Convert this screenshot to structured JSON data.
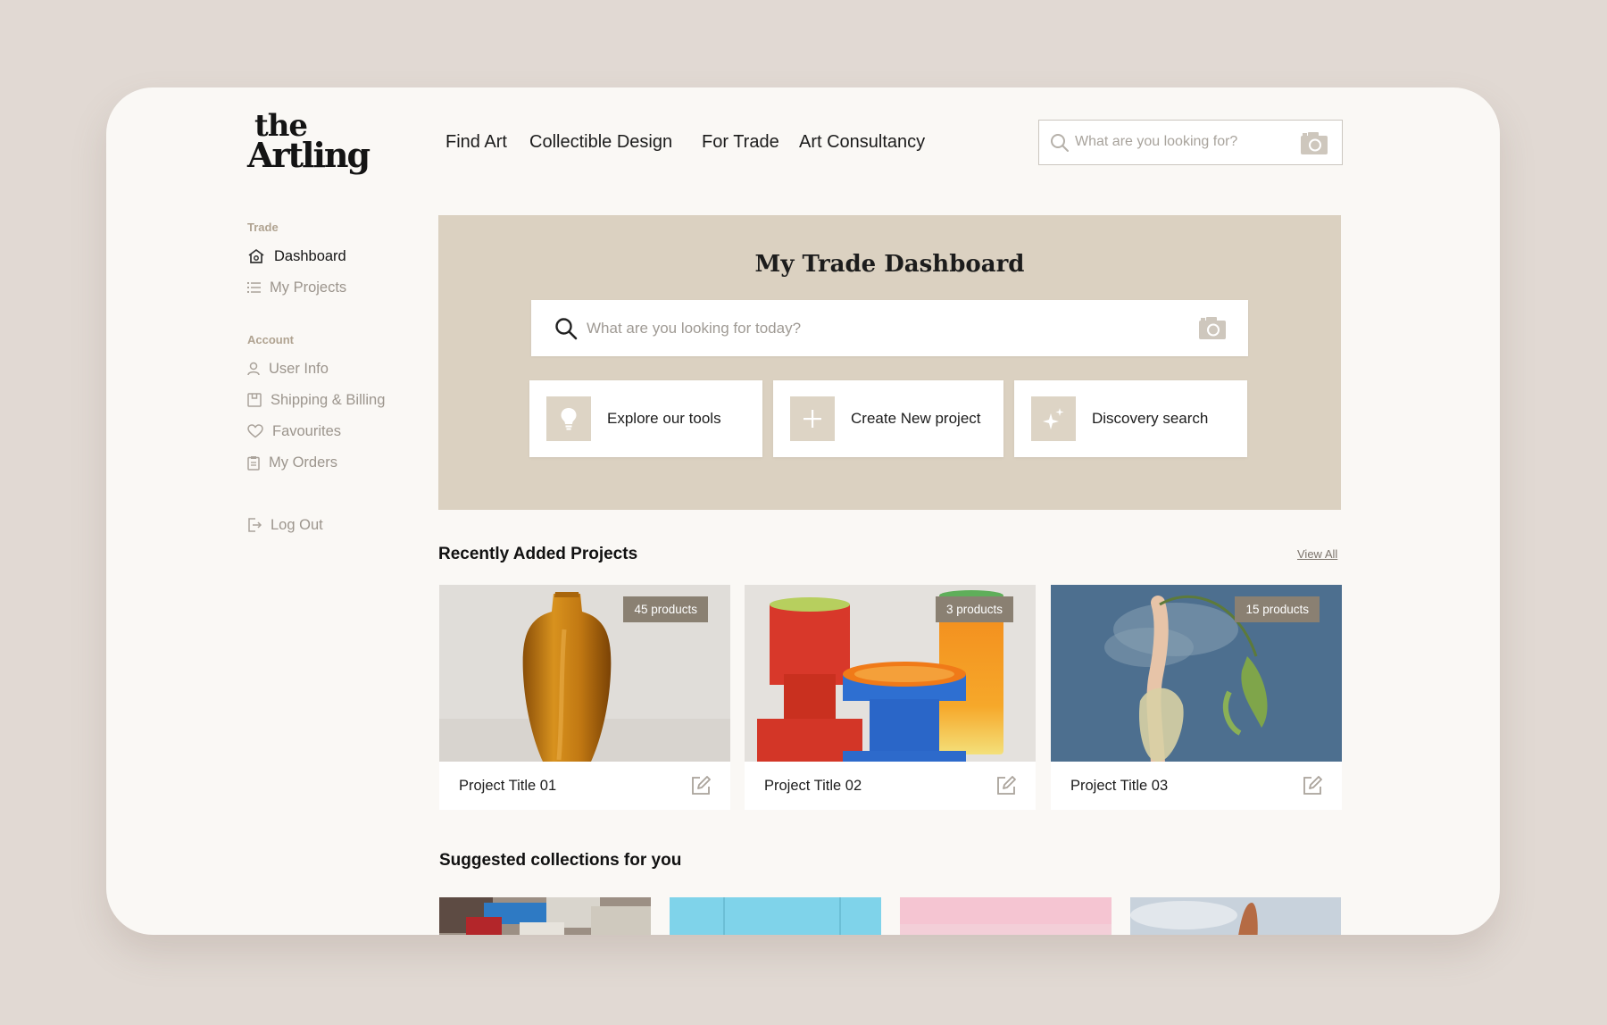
{
  "logo": {
    "line1": "the",
    "line2": "Artling"
  },
  "nav": {
    "items": [
      {
        "label": "Find Art"
      },
      {
        "label": "Collectible Design"
      },
      {
        "label": "For Trade"
      },
      {
        "label": "Art Consultancy"
      }
    ]
  },
  "top_search": {
    "placeholder": "What are you looking for?"
  },
  "sidebar": {
    "trade_heading": "Trade",
    "trade_items": [
      {
        "label": "Dashboard",
        "icon": "house-icon",
        "active": true
      },
      {
        "label": "My Projects",
        "icon": "list-icon",
        "active": false
      }
    ],
    "account_heading": "Account",
    "account_items": [
      {
        "label": "User Info",
        "icon": "user-icon"
      },
      {
        "label": "Shipping & Billing",
        "icon": "box-icon"
      },
      {
        "label": "Favourites",
        "icon": "heart-icon"
      },
      {
        "label": "My Orders",
        "icon": "clipboard-icon"
      }
    ],
    "logout": {
      "label": "Log Out",
      "icon": "logout-icon"
    }
  },
  "hero": {
    "title": "My Trade Dashboard",
    "search_placeholder": "What are you looking for today?",
    "actions": [
      {
        "label": "Explore our tools",
        "icon": "lightbulb-icon"
      },
      {
        "label": "Create New project",
        "icon": "plus-icon"
      },
      {
        "label": "Discovery search",
        "icon": "sparkle-icon"
      }
    ]
  },
  "recent": {
    "title": "Recently Added Projects",
    "view_all": "View All",
    "projects": [
      {
        "title": "Project Title 01",
        "badge": "45 products"
      },
      {
        "title": "Project Title 02",
        "badge": "3 products"
      },
      {
        "title": "Project Title 03",
        "badge": "15 products"
      }
    ]
  },
  "suggested": {
    "title": "Suggested collections for you"
  },
  "colors": {
    "page_bg": "#e1d9d3",
    "frame_bg": "#faf8f5",
    "hero_bg": "#dbd1c1",
    "badge_bg": "#8a8072",
    "muted_text": "#9c958d"
  }
}
